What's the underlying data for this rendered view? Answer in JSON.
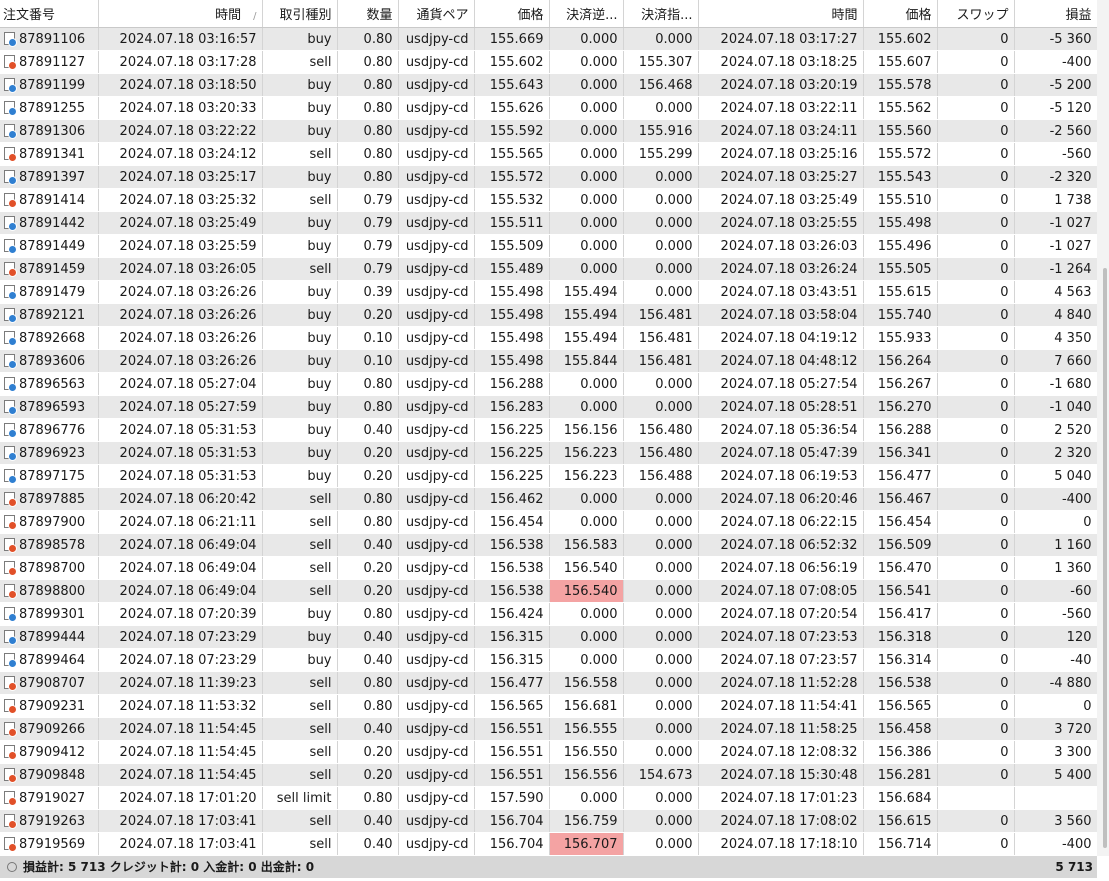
{
  "columns": [
    "注文番号",
    "時間",
    "取引種別",
    "数量",
    "通貨ペア",
    "価格",
    "決済逆...",
    "決済指...",
    "時間",
    "価格",
    "スワップ",
    "損益"
  ],
  "sort_indicator": "/",
  "colors": {
    "buy_icon": "#2f7fd1",
    "sell_icon": "#e15028",
    "highlight": "#f4a3a3",
    "row_shade": "#e8e8e8"
  },
  "rows": [
    {
      "id": "87891106",
      "open": "2024.07.18 03:16:57",
      "type": "buy",
      "vol": "0.80",
      "pair": "usdjpy-cd",
      "price": "155.669",
      "sl": "0.000",
      "tp": "0.000",
      "close": "2024.07.18 03:17:27",
      "cprice": "155.602",
      "swap": "0",
      "profit": "-5 360"
    },
    {
      "id": "87891127",
      "open": "2024.07.18 03:17:28",
      "type": "sell",
      "vol": "0.80",
      "pair": "usdjpy-cd",
      "price": "155.602",
      "sl": "0.000",
      "tp": "155.307",
      "close": "2024.07.18 03:18:25",
      "cprice": "155.607",
      "swap": "0",
      "profit": "-400"
    },
    {
      "id": "87891199",
      "open": "2024.07.18 03:18:50",
      "type": "buy",
      "vol": "0.80",
      "pair": "usdjpy-cd",
      "price": "155.643",
      "sl": "0.000",
      "tp": "156.468",
      "close": "2024.07.18 03:20:19",
      "cprice": "155.578",
      "swap": "0",
      "profit": "-5 200"
    },
    {
      "id": "87891255",
      "open": "2024.07.18 03:20:33",
      "type": "buy",
      "vol": "0.80",
      "pair": "usdjpy-cd",
      "price": "155.626",
      "sl": "0.000",
      "tp": "0.000",
      "close": "2024.07.18 03:22:11",
      "cprice": "155.562",
      "swap": "0",
      "profit": "-5 120"
    },
    {
      "id": "87891306",
      "open": "2024.07.18 03:22:22",
      "type": "buy",
      "vol": "0.80",
      "pair": "usdjpy-cd",
      "price": "155.592",
      "sl": "0.000",
      "tp": "155.916",
      "close": "2024.07.18 03:24:11",
      "cprice": "155.560",
      "swap": "0",
      "profit": "-2 560"
    },
    {
      "id": "87891341",
      "open": "2024.07.18 03:24:12",
      "type": "sell",
      "vol": "0.80",
      "pair": "usdjpy-cd",
      "price": "155.565",
      "sl": "0.000",
      "tp": "155.299",
      "close": "2024.07.18 03:25:16",
      "cprice": "155.572",
      "swap": "0",
      "profit": "-560"
    },
    {
      "id": "87891397",
      "open": "2024.07.18 03:25:17",
      "type": "buy",
      "vol": "0.80",
      "pair": "usdjpy-cd",
      "price": "155.572",
      "sl": "0.000",
      "tp": "0.000",
      "close": "2024.07.18 03:25:27",
      "cprice": "155.543",
      "swap": "0",
      "profit": "-2 320"
    },
    {
      "id": "87891414",
      "open": "2024.07.18 03:25:32",
      "type": "sell",
      "vol": "0.79",
      "pair": "usdjpy-cd",
      "price": "155.532",
      "sl": "0.000",
      "tp": "0.000",
      "close": "2024.07.18 03:25:49",
      "cprice": "155.510",
      "swap": "0",
      "profit": "1 738"
    },
    {
      "id": "87891442",
      "open": "2024.07.18 03:25:49",
      "type": "buy",
      "vol": "0.79",
      "pair": "usdjpy-cd",
      "price": "155.511",
      "sl": "0.000",
      "tp": "0.000",
      "close": "2024.07.18 03:25:55",
      "cprice": "155.498",
      "swap": "0",
      "profit": "-1 027"
    },
    {
      "id": "87891449",
      "open": "2024.07.18 03:25:59",
      "type": "buy",
      "vol": "0.79",
      "pair": "usdjpy-cd",
      "price": "155.509",
      "sl": "0.000",
      "tp": "0.000",
      "close": "2024.07.18 03:26:03",
      "cprice": "155.496",
      "swap": "0",
      "profit": "-1 027"
    },
    {
      "id": "87891459",
      "open": "2024.07.18 03:26:05",
      "type": "sell",
      "vol": "0.79",
      "pair": "usdjpy-cd",
      "price": "155.489",
      "sl": "0.000",
      "tp": "0.000",
      "close": "2024.07.18 03:26:24",
      "cprice": "155.505",
      "swap": "0",
      "profit": "-1 264"
    },
    {
      "id": "87891479",
      "open": "2024.07.18 03:26:26",
      "type": "buy",
      "vol": "0.39",
      "pair": "usdjpy-cd",
      "price": "155.498",
      "sl": "155.494",
      "tp": "0.000",
      "close": "2024.07.18 03:43:51",
      "cprice": "155.615",
      "swap": "0",
      "profit": "4 563"
    },
    {
      "id": "87892121",
      "open": "2024.07.18 03:26:26",
      "type": "buy",
      "vol": "0.20",
      "pair": "usdjpy-cd",
      "price": "155.498",
      "sl": "155.494",
      "tp": "156.481",
      "close": "2024.07.18 03:58:04",
      "cprice": "155.740",
      "swap": "0",
      "profit": "4 840"
    },
    {
      "id": "87892668",
      "open": "2024.07.18 03:26:26",
      "type": "buy",
      "vol": "0.10",
      "pair": "usdjpy-cd",
      "price": "155.498",
      "sl": "155.494",
      "tp": "156.481",
      "close": "2024.07.18 04:19:12",
      "cprice": "155.933",
      "swap": "0",
      "profit": "4 350"
    },
    {
      "id": "87893606",
      "open": "2024.07.18 03:26:26",
      "type": "buy",
      "vol": "0.10",
      "pair": "usdjpy-cd",
      "price": "155.498",
      "sl": "155.844",
      "tp": "156.481",
      "close": "2024.07.18 04:48:12",
      "cprice": "156.264",
      "swap": "0",
      "profit": "7 660"
    },
    {
      "id": "87896563",
      "open": "2024.07.18 05:27:04",
      "type": "buy",
      "vol": "0.80",
      "pair": "usdjpy-cd",
      "price": "156.288",
      "sl": "0.000",
      "tp": "0.000",
      "close": "2024.07.18 05:27:54",
      "cprice": "156.267",
      "swap": "0",
      "profit": "-1 680"
    },
    {
      "id": "87896593",
      "open": "2024.07.18 05:27:59",
      "type": "buy",
      "vol": "0.80",
      "pair": "usdjpy-cd",
      "price": "156.283",
      "sl": "0.000",
      "tp": "0.000",
      "close": "2024.07.18 05:28:51",
      "cprice": "156.270",
      "swap": "0",
      "profit": "-1 040"
    },
    {
      "id": "87896776",
      "open": "2024.07.18 05:31:53",
      "type": "buy",
      "vol": "0.40",
      "pair": "usdjpy-cd",
      "price": "156.225",
      "sl": "156.156",
      "tp": "156.480",
      "close": "2024.07.18 05:36:54",
      "cprice": "156.288",
      "swap": "0",
      "profit": "2 520"
    },
    {
      "id": "87896923",
      "open": "2024.07.18 05:31:53",
      "type": "buy",
      "vol": "0.20",
      "pair": "usdjpy-cd",
      "price": "156.225",
      "sl": "156.223",
      "tp": "156.480",
      "close": "2024.07.18 05:47:39",
      "cprice": "156.341",
      "swap": "0",
      "profit": "2 320"
    },
    {
      "id": "87897175",
      "open": "2024.07.18 05:31:53",
      "type": "buy",
      "vol": "0.20",
      "pair": "usdjpy-cd",
      "price": "156.225",
      "sl": "156.223",
      "tp": "156.488",
      "close": "2024.07.18 06:19:53",
      "cprice": "156.477",
      "swap": "0",
      "profit": "5 040"
    },
    {
      "id": "87897885",
      "open": "2024.07.18 06:20:42",
      "type": "sell",
      "vol": "0.80",
      "pair": "usdjpy-cd",
      "price": "156.462",
      "sl": "0.000",
      "tp": "0.000",
      "close": "2024.07.18 06:20:46",
      "cprice": "156.467",
      "swap": "0",
      "profit": "-400"
    },
    {
      "id": "87897900",
      "open": "2024.07.18 06:21:11",
      "type": "sell",
      "vol": "0.80",
      "pair": "usdjpy-cd",
      "price": "156.454",
      "sl": "0.000",
      "tp": "0.000",
      "close": "2024.07.18 06:22:15",
      "cprice": "156.454",
      "swap": "0",
      "profit": "0"
    },
    {
      "id": "87898578",
      "open": "2024.07.18 06:49:04",
      "type": "sell",
      "vol": "0.40",
      "pair": "usdjpy-cd",
      "price": "156.538",
      "sl": "156.583",
      "tp": "0.000",
      "close": "2024.07.18 06:52:32",
      "cprice": "156.509",
      "swap": "0",
      "profit": "1 160"
    },
    {
      "id": "87898700",
      "open": "2024.07.18 06:49:04",
      "type": "sell",
      "vol": "0.20",
      "pair": "usdjpy-cd",
      "price": "156.538",
      "sl": "156.540",
      "tp": "0.000",
      "close": "2024.07.18 06:56:19",
      "cprice": "156.470",
      "swap": "0",
      "profit": "1 360"
    },
    {
      "id": "87898800",
      "open": "2024.07.18 06:49:04",
      "type": "sell",
      "vol": "0.20",
      "pair": "usdjpy-cd",
      "price": "156.538",
      "sl": "156.540",
      "tp": "0.000",
      "close": "2024.07.18 07:08:05",
      "cprice": "156.541",
      "swap": "0",
      "profit": "-60",
      "highlight_sl": true
    },
    {
      "id": "87899301",
      "open": "2024.07.18 07:20:39",
      "type": "buy",
      "vol": "0.80",
      "pair": "usdjpy-cd",
      "price": "156.424",
      "sl": "0.000",
      "tp": "0.000",
      "close": "2024.07.18 07:20:54",
      "cprice": "156.417",
      "swap": "0",
      "profit": "-560"
    },
    {
      "id": "87899444",
      "open": "2024.07.18 07:23:29",
      "type": "buy",
      "vol": "0.40",
      "pair": "usdjpy-cd",
      "price": "156.315",
      "sl": "0.000",
      "tp": "0.000",
      "close": "2024.07.18 07:23:53",
      "cprice": "156.318",
      "swap": "0",
      "profit": "120"
    },
    {
      "id": "87899464",
      "open": "2024.07.18 07:23:29",
      "type": "buy",
      "vol": "0.40",
      "pair": "usdjpy-cd",
      "price": "156.315",
      "sl": "0.000",
      "tp": "0.000",
      "close": "2024.07.18 07:23:57",
      "cprice": "156.314",
      "swap": "0",
      "profit": "-40"
    },
    {
      "id": "87908707",
      "open": "2024.07.18 11:39:23",
      "type": "sell",
      "vol": "0.80",
      "pair": "usdjpy-cd",
      "price": "156.477",
      "sl": "156.558",
      "tp": "0.000",
      "close": "2024.07.18 11:52:28",
      "cprice": "156.538",
      "swap": "0",
      "profit": "-4 880"
    },
    {
      "id": "87909231",
      "open": "2024.07.18 11:53:32",
      "type": "sell",
      "vol": "0.80",
      "pair": "usdjpy-cd",
      "price": "156.565",
      "sl": "156.681",
      "tp": "0.000",
      "close": "2024.07.18 11:54:41",
      "cprice": "156.565",
      "swap": "0",
      "profit": "0"
    },
    {
      "id": "87909266",
      "open": "2024.07.18 11:54:45",
      "type": "sell",
      "vol": "0.40",
      "pair": "usdjpy-cd",
      "price": "156.551",
      "sl": "156.555",
      "tp": "0.000",
      "close": "2024.07.18 11:58:25",
      "cprice": "156.458",
      "swap": "0",
      "profit": "3 720"
    },
    {
      "id": "87909412",
      "open": "2024.07.18 11:54:45",
      "type": "sell",
      "vol": "0.20",
      "pair": "usdjpy-cd",
      "price": "156.551",
      "sl": "156.550",
      "tp": "0.000",
      "close": "2024.07.18 12:08:32",
      "cprice": "156.386",
      "swap": "0",
      "profit": "3 300"
    },
    {
      "id": "87909848",
      "open": "2024.07.18 11:54:45",
      "type": "sell",
      "vol": "0.20",
      "pair": "usdjpy-cd",
      "price": "156.551",
      "sl": "156.556",
      "tp": "154.673",
      "close": "2024.07.18 15:30:48",
      "cprice": "156.281",
      "swap": "0",
      "profit": "5 400"
    },
    {
      "id": "87919027",
      "open": "2024.07.18 17:01:20",
      "type": "sell limit",
      "vol": "0.80",
      "pair": "usdjpy-cd",
      "price": "157.590",
      "sl": "0.000",
      "tp": "0.000",
      "close": "2024.07.18 17:01:23",
      "cprice": "156.684",
      "swap": "",
      "profit": "",
      "pending": true
    },
    {
      "id": "87919263",
      "open": "2024.07.18 17:03:41",
      "type": "sell",
      "vol": "0.40",
      "pair": "usdjpy-cd",
      "price": "156.704",
      "sl": "156.759",
      "tp": "0.000",
      "close": "2024.07.18 17:08:02",
      "cprice": "156.615",
      "swap": "0",
      "profit": "3 560"
    },
    {
      "id": "87919569",
      "open": "2024.07.18 17:03:41",
      "type": "sell",
      "vol": "0.40",
      "pair": "usdjpy-cd",
      "price": "156.704",
      "sl": "156.707",
      "tp": "0.000",
      "close": "2024.07.18 17:18:10",
      "cprice": "156.714",
      "swap": "0",
      "profit": "-400",
      "highlight_sl": true
    }
  ],
  "footer": {
    "summary": "損益計: 5 713  クレジット計: 0  入金計: 0  出金計: 0",
    "total": "5 713"
  }
}
